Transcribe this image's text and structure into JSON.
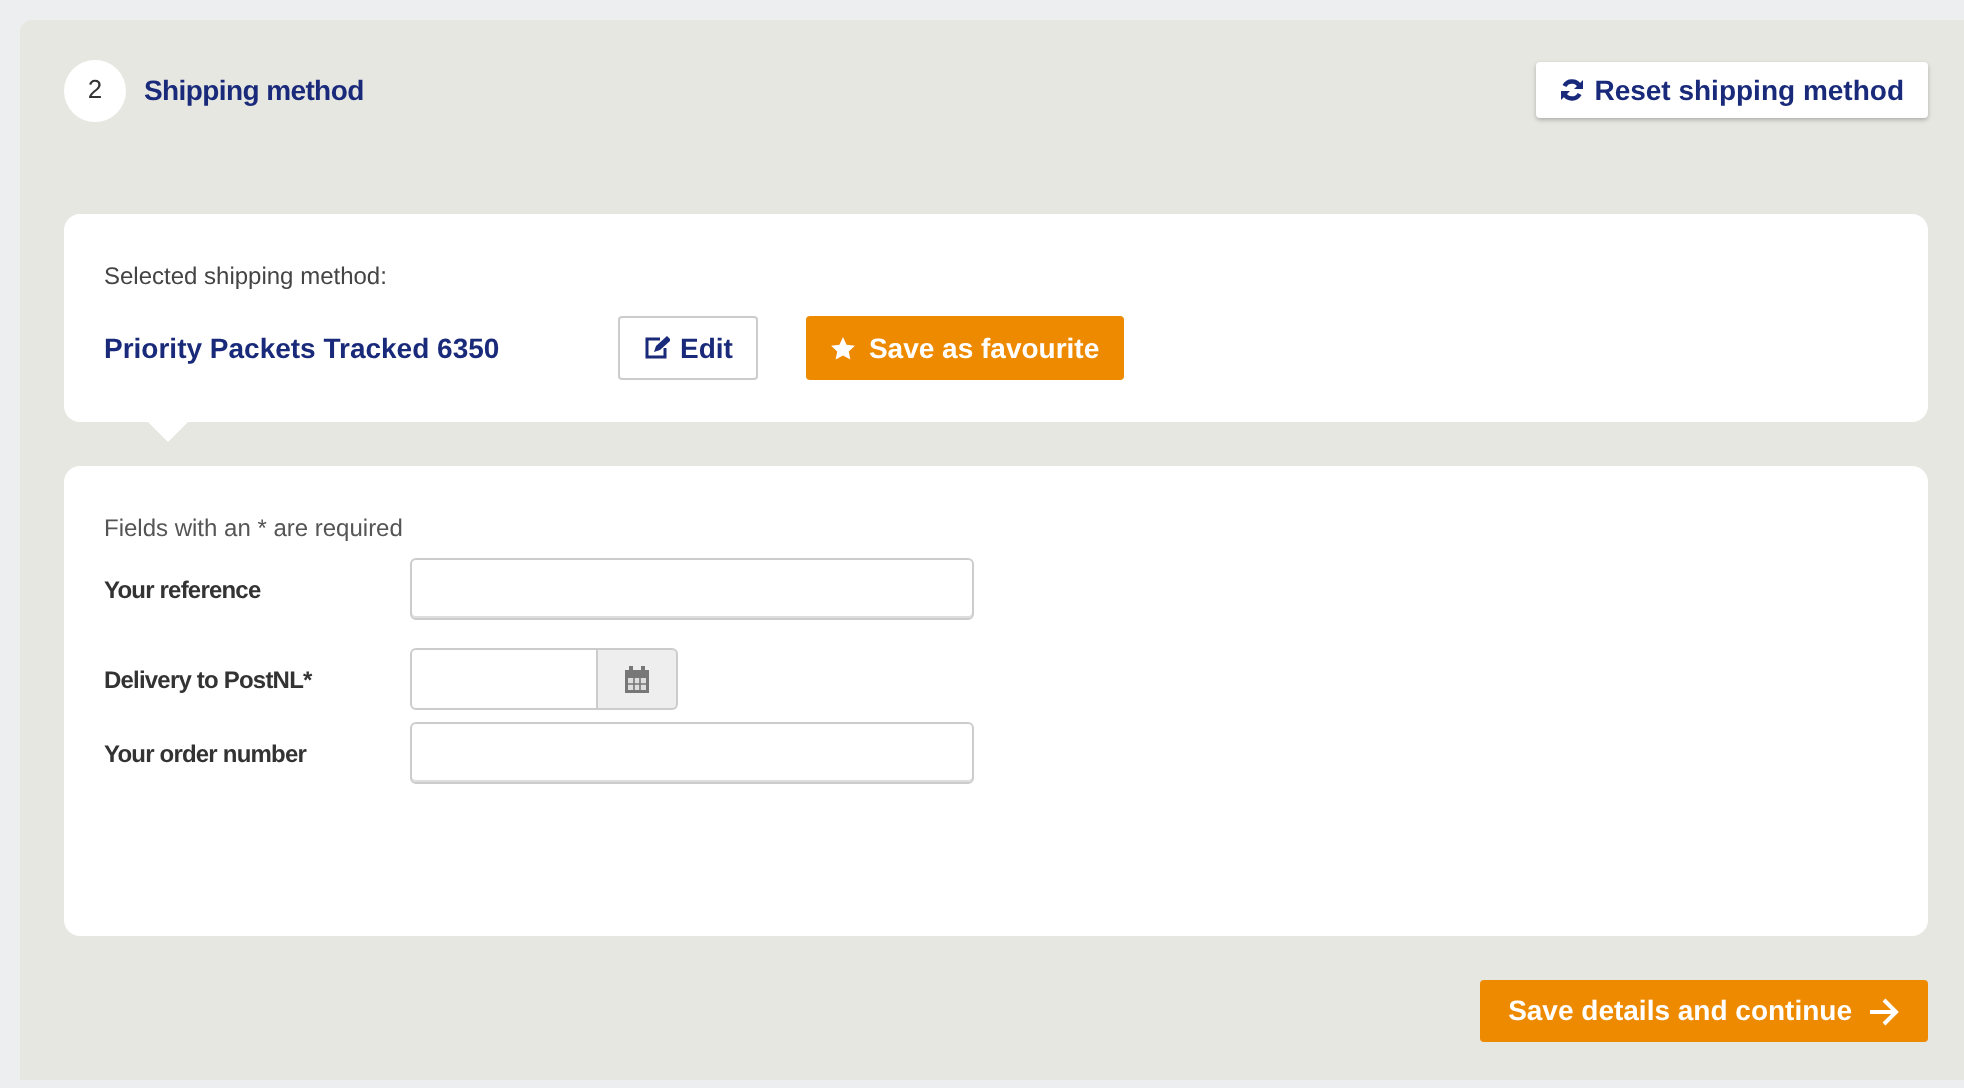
{
  "step": {
    "number": "2",
    "title": "Shipping method"
  },
  "reset_button": "Reset shipping method",
  "selected_method": {
    "label": "Selected shipping method:",
    "name": "Priority Packets Tracked 6350",
    "edit_button": "Edit",
    "favourite_button": "Save as favourite"
  },
  "form": {
    "note": "Fields with an * are required",
    "fields": [
      {
        "label": "Your reference",
        "kind": "text"
      },
      {
        "label": "Delivery to PostNL*",
        "kind": "date"
      },
      {
        "label": "Your order number",
        "kind": "text"
      }
    ]
  },
  "continue_button": "Save details and continue"
}
